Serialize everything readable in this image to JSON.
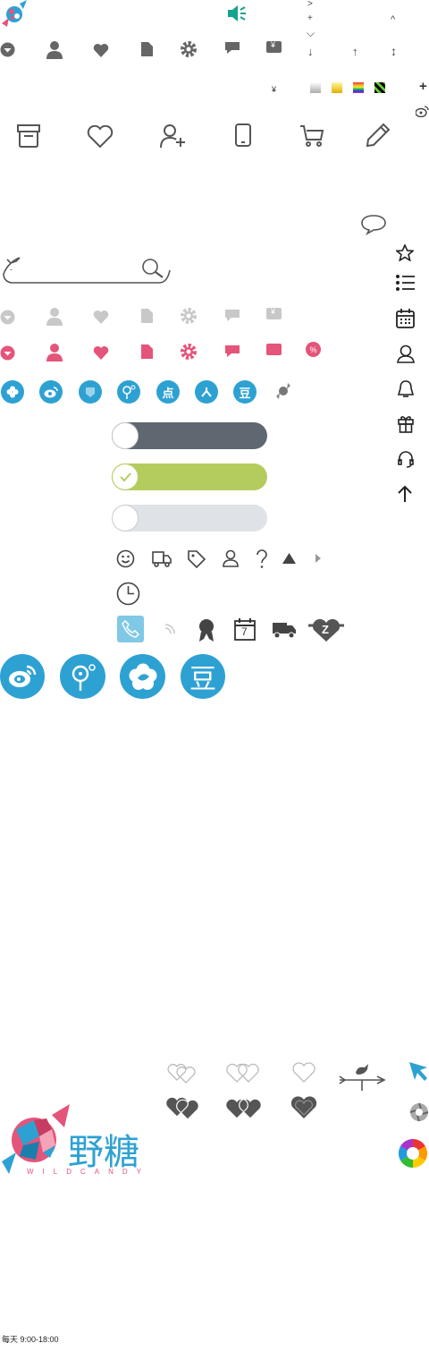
{
  "colors": {
    "gray": "#666666",
    "light_gray": "#c8c8c8",
    "pink": "#e5547a",
    "blue": "#2ea1d3",
    "teal": "#14a38b",
    "toggle_dark": "#5f6770",
    "toggle_on": "#b4cc5e",
    "toggle_off": "#dfe2e6",
    "phone_bg": "#7fc9e6"
  },
  "labels": {
    "yen": "¥",
    "yen_small": "¥",
    "percent": "%",
    "dian": "点",
    "dou": "豆",
    "dou_large": "豆",
    "calendar_day": "7",
    "heart_badge": "Z",
    "arrow_right": ">",
    "plus": "+",
    "chevron_down": "⌵",
    "caret_up": "^",
    "arrow_down": "↓",
    "arrow_up": "↑",
    "arrow_updown": "↕",
    "plus_bold": "+",
    "tiny_mark": "-"
  },
  "brand": {
    "logo_cn": "野糖",
    "logo_en": "WILDCANDY"
  },
  "footer": {
    "hours": "每天 9:00-18:00"
  },
  "toggles": {
    "first": "off-dark",
    "second": "on",
    "third": "off-light"
  }
}
